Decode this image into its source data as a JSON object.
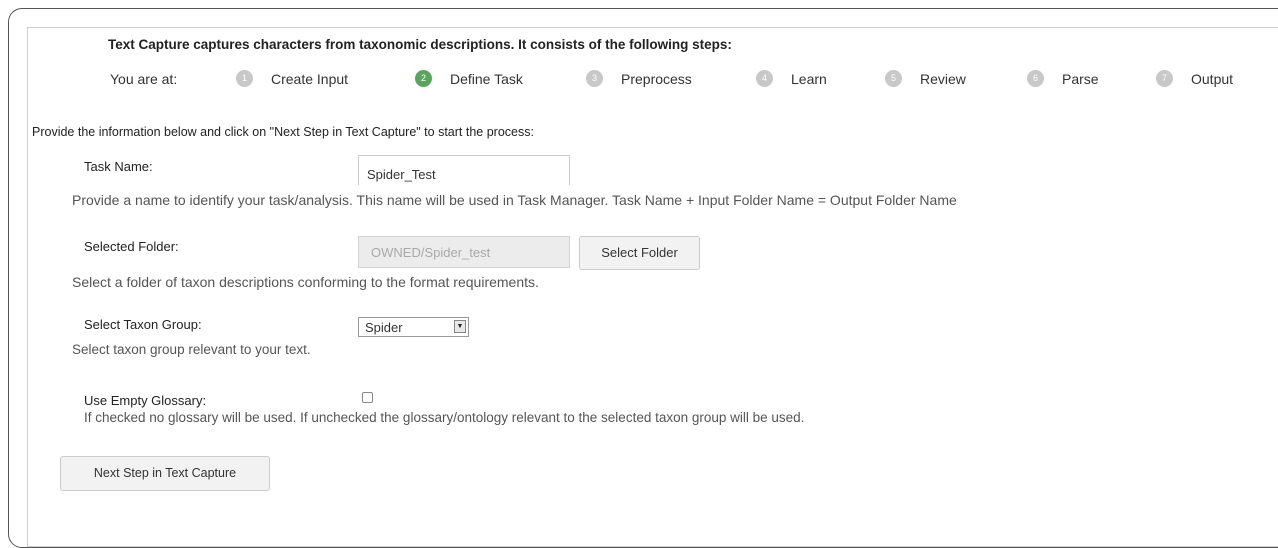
{
  "intro": "Text Capture captures characters from taxonomic descriptions. It consists of the following steps:",
  "steps": {
    "you_are_at": "You are at:",
    "items": [
      {
        "num": "1",
        "label": "Create Input",
        "active": false
      },
      {
        "num": "2",
        "label": "Define Task",
        "active": true
      },
      {
        "num": "3",
        "label": "Preprocess",
        "active": false
      },
      {
        "num": "4",
        "label": "Learn",
        "active": false
      },
      {
        "num": "5",
        "label": "Review",
        "active": false
      },
      {
        "num": "6",
        "label": "Parse",
        "active": false
      },
      {
        "num": "7",
        "label": "Output",
        "active": false
      }
    ],
    "active_color": "#5aa55c",
    "inactive_color": "#c8c8c8"
  },
  "instructions": "Provide the information below and click on \"Next Step in Text Capture\" to start the process:",
  "task_name": {
    "label": "Task Name:",
    "value": "Spider_Test",
    "help": "Provide a name to identify your task/analysis. This name will be used in Task Manager. Task Name + Input Folder Name = Output Folder Name"
  },
  "selected_folder": {
    "label": "Selected Folder:",
    "value": "OWNED/Spider_test",
    "button": "Select Folder",
    "help": "Select a folder of taxon descriptions conforming to the format requirements."
  },
  "taxon_group": {
    "label": "Select Taxon Group:",
    "selected": "Spider",
    "help": "Select taxon group relevant to your text."
  },
  "empty_glossary": {
    "label": "Use Empty Glossary:",
    "checked": false,
    "help": "If checked no glossary will be used. If unchecked the glossary/ontology relevant to the selected taxon group will be used."
  },
  "next_button": "Next Step in Text Capture"
}
